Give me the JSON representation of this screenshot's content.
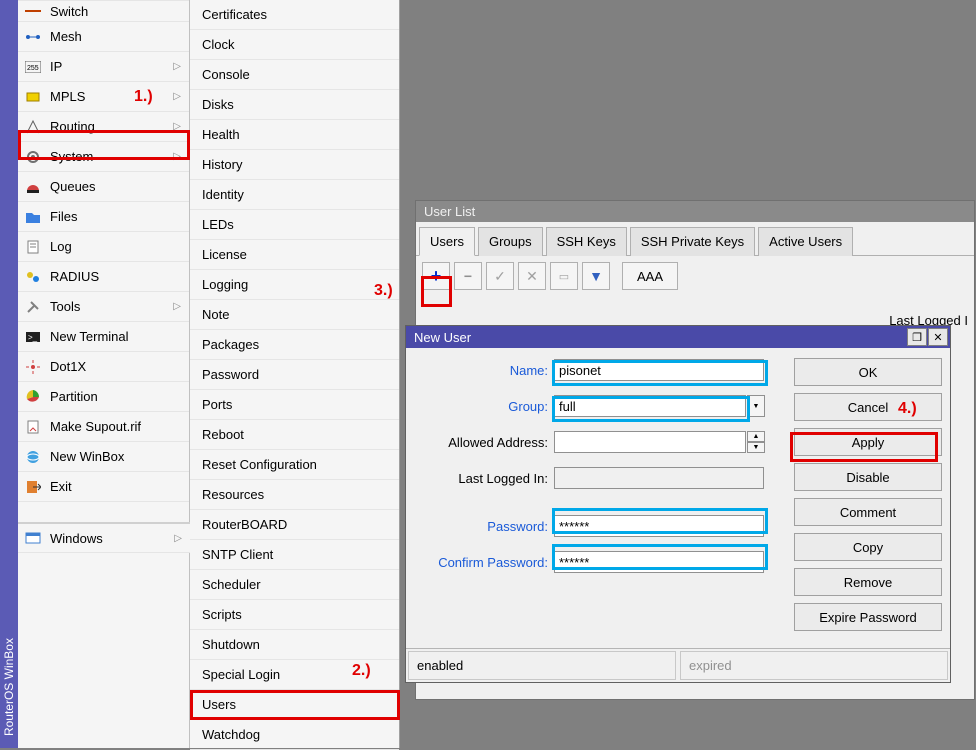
{
  "app_title": "RouterOS WinBox",
  "sidebar": {
    "items": [
      {
        "label": "Switch",
        "icon": "switch"
      },
      {
        "label": "Mesh",
        "icon": "mesh"
      },
      {
        "label": "IP",
        "icon": "ip",
        "arrow": true
      },
      {
        "label": "MPLS",
        "icon": "mpls",
        "arrow": true
      },
      {
        "label": "Routing",
        "icon": "routing",
        "arrow": true
      },
      {
        "label": "System",
        "icon": "system",
        "arrow": true
      },
      {
        "label": "Queues",
        "icon": "queues"
      },
      {
        "label": "Files",
        "icon": "files"
      },
      {
        "label": "Log",
        "icon": "log"
      },
      {
        "label": "RADIUS",
        "icon": "radius"
      },
      {
        "label": "Tools",
        "icon": "tools",
        "arrow": true
      },
      {
        "label": "New Terminal",
        "icon": "terminal"
      },
      {
        "label": "Dot1X",
        "icon": "dot1x"
      },
      {
        "label": "Partition",
        "icon": "partition"
      },
      {
        "label": "Make Supout.rif",
        "icon": "supout"
      },
      {
        "label": "New WinBox",
        "icon": "winbox"
      },
      {
        "label": "Exit",
        "icon": "exit"
      }
    ],
    "windows_label": "Windows"
  },
  "submenu": {
    "items": [
      "Certificates",
      "Clock",
      "Console",
      "Disks",
      "Health",
      "History",
      "Identity",
      "LEDs",
      "License",
      "Logging",
      "Note",
      "Packages",
      "Password",
      "Ports",
      "Reboot",
      "Reset Configuration",
      "Resources",
      "RouterBOARD",
      "SNTP Client",
      "Scheduler",
      "Scripts",
      "Shutdown",
      "Special Login",
      "Users",
      "Watchdog"
    ]
  },
  "annotations": {
    "n1": "1.)",
    "n2": "2.)",
    "n3": "3.)",
    "n4": "4.)"
  },
  "userlist": {
    "title": "User List",
    "tabs": [
      "Users",
      "Groups",
      "SSH Keys",
      "SSH Private Keys",
      "Active Users"
    ],
    "toolbar_aaa": "AAA",
    "col_lastlog": "Last Logged I"
  },
  "newuser": {
    "title": "New User",
    "labels": {
      "name": "Name:",
      "group": "Group:",
      "allowed": "Allowed Address:",
      "lastlog": "Last Logged In:",
      "password": "Password:",
      "confirm": "Confirm Password:"
    },
    "values": {
      "name": "pisonet",
      "group": "full",
      "allowed": "",
      "lastlog": "",
      "password": "******",
      "confirm": "******"
    },
    "buttons": {
      "ok": "OK",
      "cancel": "Cancel",
      "apply": "Apply",
      "disable": "Disable",
      "comment": "Comment",
      "copy": "Copy",
      "remove": "Remove",
      "expire": "Expire Password"
    },
    "status": {
      "enabled": "enabled",
      "expired": "expired"
    }
  }
}
